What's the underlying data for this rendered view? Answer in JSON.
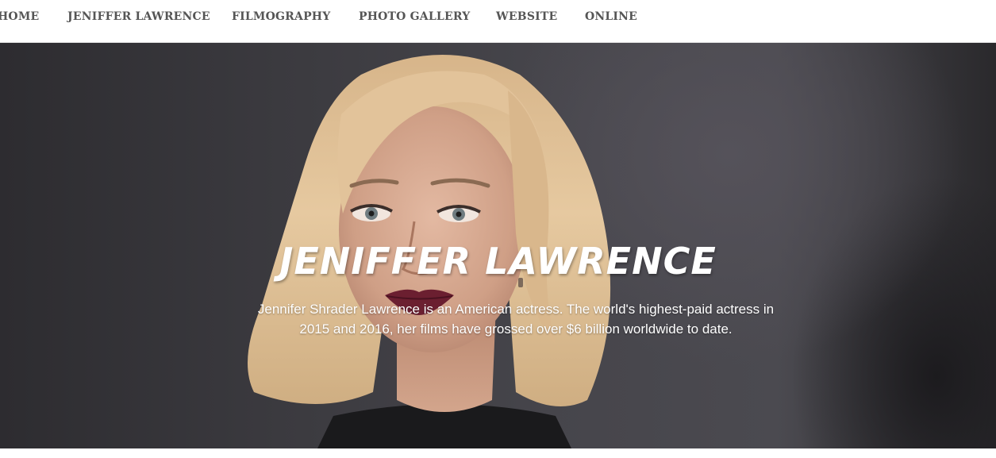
{
  "nav": {
    "items": [
      {
        "label": "HOME"
      },
      {
        "label": "JENIFFER LAWRENCE"
      },
      {
        "label": "FILMOGRAPHY"
      },
      {
        "label": "PHOTO GALLERY"
      },
      {
        "label": "WEBSITE"
      },
      {
        "label": "ONLINE"
      }
    ]
  },
  "hero": {
    "title": "JENIFFER LAWRENCE",
    "description": "Jennifer Shrader Lawrence is an American actress. The world's highest-paid actress in 2015 and 2016, her films have grossed over $6 billion worldwide to date."
  },
  "colors": {
    "nav_text": "#555555",
    "hero_text": "#ffffff",
    "hero_background": "#3b3a3f"
  }
}
